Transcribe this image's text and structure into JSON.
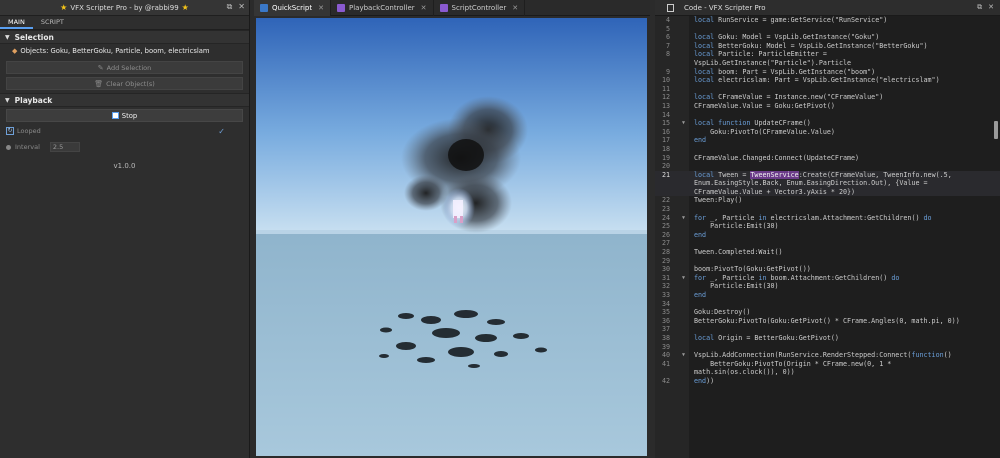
{
  "left": {
    "title": "VFX Scripter Pro - by @rabbi99",
    "tabs": [
      "MAIN",
      "SCRIPT"
    ],
    "selection": {
      "header": "Selection",
      "objects_text": "Objects: Goku, BetterGoku, Particle, boom, electricslam",
      "add_label": "Add Selection",
      "clear_label": "Clear Object(s)"
    },
    "playback": {
      "header": "Playback",
      "stop_label": "Stop",
      "looped_label": "Looped",
      "interval_label": "Interval",
      "interval_value": "2.5"
    },
    "version": "v1.0.0"
  },
  "mid": {
    "tabs": [
      {
        "label": "QuickScript",
        "icon_color": "#3a78c8"
      },
      {
        "label": "PlaybackController",
        "icon_color": "#8a5ad0"
      },
      {
        "label": "ScriptController",
        "icon_color": "#8a5ad0"
      }
    ]
  },
  "right": {
    "title": "Code - VFX Scripter Pro",
    "lines": [
      {
        "n": "4",
        "t": "local RunService = game:GetService(\"RunService\")"
      },
      {
        "n": "5",
        "t": ""
      },
      {
        "n": "6",
        "t": "local Goku: Model = VspLib.GetInstance(\"Goku\")"
      },
      {
        "n": "7",
        "t": "local BetterGoku: Model = VspLib.GetInstance(\"BetterGoku\")"
      },
      {
        "n": "8",
        "t": "local Particle: ParticleEmitter ="
      },
      {
        "n": "",
        "t": "VspLib.GetInstance(\"Particle\").Particle"
      },
      {
        "n": "9",
        "t": "local boom: Part = VspLib.GetInstance(\"boom\")"
      },
      {
        "n": "10",
        "t": "local electricslam: Part = VspLib.GetInstance(\"electricslam\")"
      },
      {
        "n": "11",
        "t": ""
      },
      {
        "n": "12",
        "t": "local CFrameValue = Instance.new(\"CFrameValue\")"
      },
      {
        "n": "13",
        "t": "CFrameValue.Value = Goku:GetPivot()"
      },
      {
        "n": "14",
        "t": ""
      },
      {
        "n": "15",
        "t": "local function UpdateCFrame()",
        "fold": true
      },
      {
        "n": "16",
        "t": "    Goku:PivotTo(CFrameValue.Value)"
      },
      {
        "n": "17",
        "t": "end"
      },
      {
        "n": "18",
        "t": ""
      },
      {
        "n": "19",
        "t": "CFrameValue.Changed:Connect(UpdateCFrame)"
      },
      {
        "n": "20",
        "t": ""
      },
      {
        "n": "21",
        "t": "local Tween = TweenService:Create(CFrameValue, TweenInfo.new(.5,",
        "hl": true
      },
      {
        "n": "",
        "t": "Enum.EasingStyle.Back, Enum.EasingDirection.Out), {Value =",
        "hl": true
      },
      {
        "n": "",
        "t": "CFrameValue.Value + Vector3.yAxis * 20})",
        "hl": true
      },
      {
        "n": "22",
        "t": "Tween:Play()"
      },
      {
        "n": "23",
        "t": ""
      },
      {
        "n": "24",
        "t": "for _, Particle in electricslam.Attachment:GetChildren() do",
        "fold": true
      },
      {
        "n": "25",
        "t": "    Particle:Emit(30)"
      },
      {
        "n": "26",
        "t": "end"
      },
      {
        "n": "27",
        "t": ""
      },
      {
        "n": "28",
        "t": "Tween.Completed:Wait()"
      },
      {
        "n": "29",
        "t": ""
      },
      {
        "n": "30",
        "t": "boom:PivotTo(Goku:GetPivot())"
      },
      {
        "n": "31",
        "t": "for _, Particle in boom.Attachment:GetChildren() do",
        "fold": true
      },
      {
        "n": "32",
        "t": "    Particle:Emit(30)"
      },
      {
        "n": "33",
        "t": "end"
      },
      {
        "n": "34",
        "t": ""
      },
      {
        "n": "35",
        "t": "Goku:Destroy()"
      },
      {
        "n": "36",
        "t": "BetterGoku:PivotTo(Goku:GetPivot() * CFrame.Angles(0, math.pi, 0))"
      },
      {
        "n": "37",
        "t": ""
      },
      {
        "n": "38",
        "t": "local Origin = BetterGoku:GetPivot()"
      },
      {
        "n": "39",
        "t": ""
      },
      {
        "n": "40",
        "t": "VspLib.AddConnection(RunService.RenderStepped:Connect(function()",
        "fold": true
      },
      {
        "n": "41",
        "t": "    BetterGoku:PivotTo(Origin * CFrame.new(0, 1 *"
      },
      {
        "n": "",
        "t": "math.sin(os.clock()), 0))"
      },
      {
        "n": "42",
        "t": "end))"
      }
    ]
  }
}
